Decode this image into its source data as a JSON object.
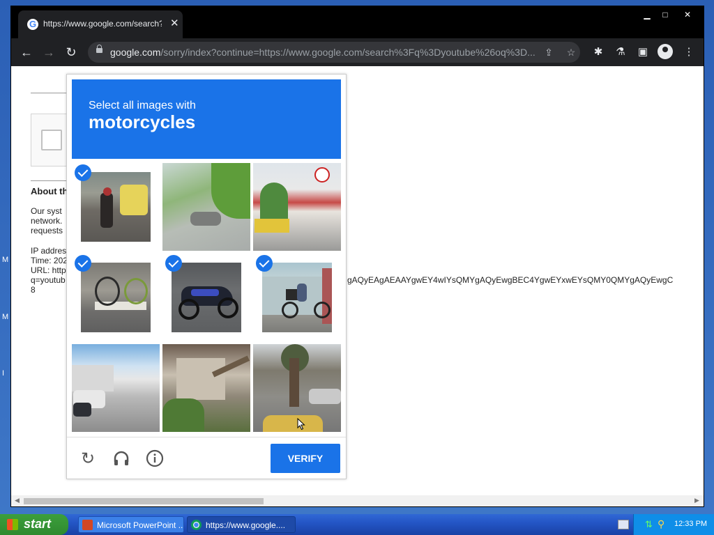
{
  "desktop": {
    "side_letters": [
      "M",
      "M",
      "I"
    ]
  },
  "browser": {
    "tab_title": "https://www.google.com/search?q=",
    "url_host": "google.com",
    "url_path": "/sorry/index?continue=https://www.google.com/search%3Fq%3Dyoutube%26oq%3D...",
    "window_controls": {
      "minimize": "▁",
      "maximize": "□",
      "close": "✕"
    }
  },
  "page": {
    "about_heading": "About th",
    "body_lines": [
      "Our syst",
      "network.",
      "requests"
    ],
    "ip_lines": [
      "IP addres",
      "Time: 202",
      "URL: http",
      "q=youtub",
      "8"
    ],
    "long_param": "gAQyEAgAEAAYgwEY4wIYsQMYgAQyEwgBEC4YgwEYxwEYsQMY0QMYgAQyEwgC"
  },
  "captcha": {
    "instruction_line1": "Select all images with",
    "instruction_target": "motorcycles",
    "verify_label": "VERIFY",
    "tiles": [
      {
        "name": "tile-1",
        "selected": true
      },
      {
        "name": "tile-2",
        "selected": false
      },
      {
        "name": "tile-3",
        "selected": false
      },
      {
        "name": "tile-4",
        "selected": true
      },
      {
        "name": "tile-5",
        "selected": true
      },
      {
        "name": "tile-6",
        "selected": true
      },
      {
        "name": "tile-7",
        "selected": false
      },
      {
        "name": "tile-8",
        "selected": false
      },
      {
        "name": "tile-9",
        "selected": false
      }
    ],
    "footer_icons": [
      "reload-icon",
      "audio-challenge-icon",
      "info-icon"
    ]
  },
  "taskbar": {
    "start_label": "start",
    "tasks": [
      {
        "label": "Microsoft PowerPoint ...",
        "icon": "powerpoint-icon"
      },
      {
        "label": "https://www.google....",
        "icon": "chrome-icon"
      }
    ],
    "clock": "12:33 PM"
  }
}
